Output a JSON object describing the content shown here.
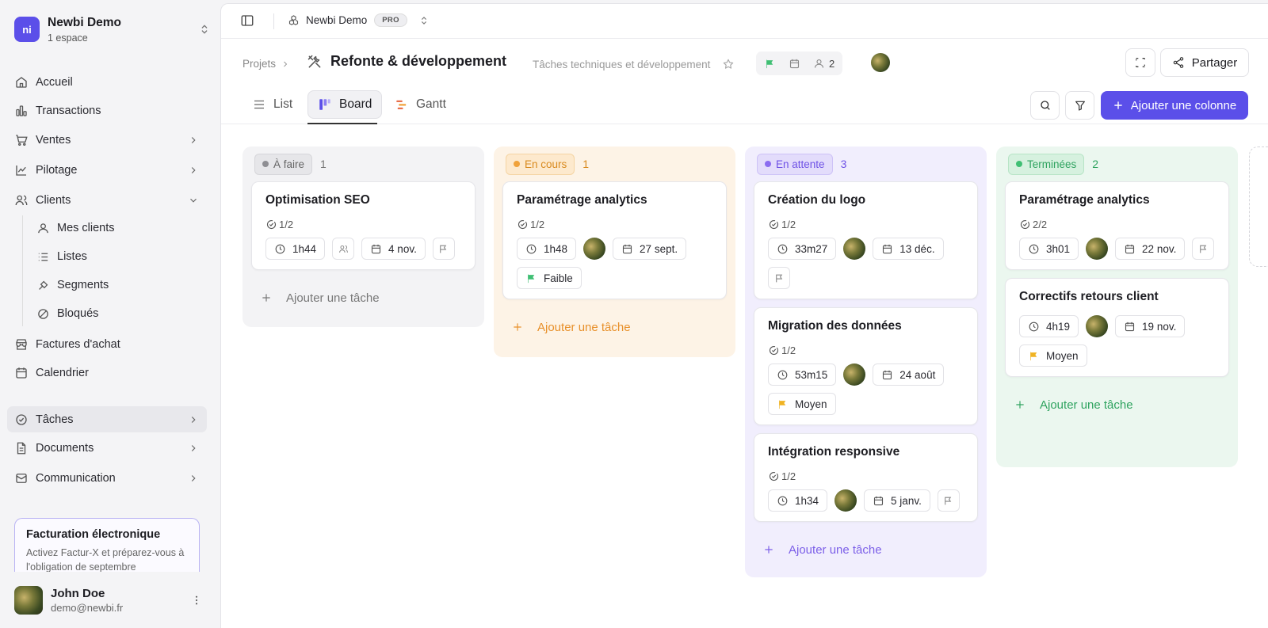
{
  "workspace": {
    "name": "Newbi Demo",
    "subtitle": "1 espace",
    "logo_text": "ni"
  },
  "sidebar": {
    "items": [
      {
        "label": "Accueil",
        "icon": "home-icon"
      },
      {
        "label": "Transactions",
        "icon": "bar-chart-icon"
      },
      {
        "label": "Ventes",
        "icon": "cart-icon"
      },
      {
        "label": "Pilotage",
        "icon": "line-chart-icon"
      },
      {
        "label": "Clients",
        "icon": "users-icon"
      },
      {
        "label": "Factures d'achat",
        "icon": "store-icon"
      },
      {
        "label": "Calendrier",
        "icon": "calendar-icon"
      },
      {
        "label": "Tâches",
        "icon": "tasks-icon"
      },
      {
        "label": "Documents",
        "icon": "document-icon"
      },
      {
        "label": "Communication",
        "icon": "mail-icon"
      }
    ],
    "client_subitems": [
      {
        "label": "Mes clients",
        "icon": "user-icon"
      },
      {
        "label": "Listes",
        "icon": "list-icon"
      },
      {
        "label": "Segments",
        "icon": "segments-icon"
      },
      {
        "label": "Bloqués",
        "icon": "blocked-icon"
      }
    ],
    "promo": {
      "title": "Facturation électronique",
      "text": "Activez Factur-X et préparez-vous à l'obligation de septembre"
    },
    "user": {
      "name": "John Doe",
      "email": "demo@newbi.fr"
    }
  },
  "topbar": {
    "project_space": "Newbi Demo",
    "plan_badge": "PRO"
  },
  "header": {
    "breadcrumb": "Projets",
    "title": "Refonte & développement",
    "description": "Tâches techniques et développement",
    "member_count": "2",
    "share_label": "Partager"
  },
  "tabs": [
    {
      "label": "List",
      "icon": "list-icon"
    },
    {
      "label": "Board",
      "icon": "board-icon"
    },
    {
      "label": "Gantt",
      "icon": "gantt-icon"
    }
  ],
  "add_column_label": "Ajouter une colonne",
  "add_task_label": "Ajouter une tâche",
  "colors": {
    "accent": "#5b4fe9",
    "todo": "#8e8e93",
    "in_progress": "#f0a23b",
    "waiting": "#8b6cf0",
    "done": "#3fbf73"
  },
  "columns": [
    {
      "status": "À faire",
      "count": "1",
      "cards": [
        {
          "title": "Optimisation SEO",
          "subtasks": "1/2",
          "time": "1h44",
          "assignee": "none",
          "date": "4 nov.",
          "priority": ""
        }
      ]
    },
    {
      "status": "En cours",
      "count": "1",
      "cards": [
        {
          "title": "Paramétrage analytics",
          "subtasks": "1/2",
          "time": "1h48",
          "assignee": "avatar",
          "date": "27 sept.",
          "priority": "Faible"
        }
      ]
    },
    {
      "status": "En attente",
      "count": "3",
      "cards": [
        {
          "title": "Création du logo",
          "subtasks": "1/2",
          "time": "33m27",
          "assignee": "avatar",
          "date": "13 déc.",
          "priority": ""
        },
        {
          "title": "Migration des données",
          "subtasks": "1/2",
          "time": "53m15",
          "assignee": "avatar",
          "date": "24 août",
          "priority": "Moyen"
        },
        {
          "title": "Intégration responsive",
          "subtasks": "1/2",
          "time": "1h34",
          "assignee": "avatar",
          "date": "5 janv.",
          "priority": ""
        }
      ]
    },
    {
      "status": "Terminées",
      "count": "2",
      "cards": [
        {
          "title": "Paramétrage analytics",
          "subtasks": "2/2",
          "time": "3h01",
          "assignee": "avatar",
          "date": "22 nov.",
          "priority": ""
        },
        {
          "title": "Correctifs retours client",
          "subtasks": "1/2",
          "time": "4h19",
          "assignee": "avatar",
          "date": "19 nov.",
          "priority": "Moyen"
        }
      ]
    }
  ]
}
